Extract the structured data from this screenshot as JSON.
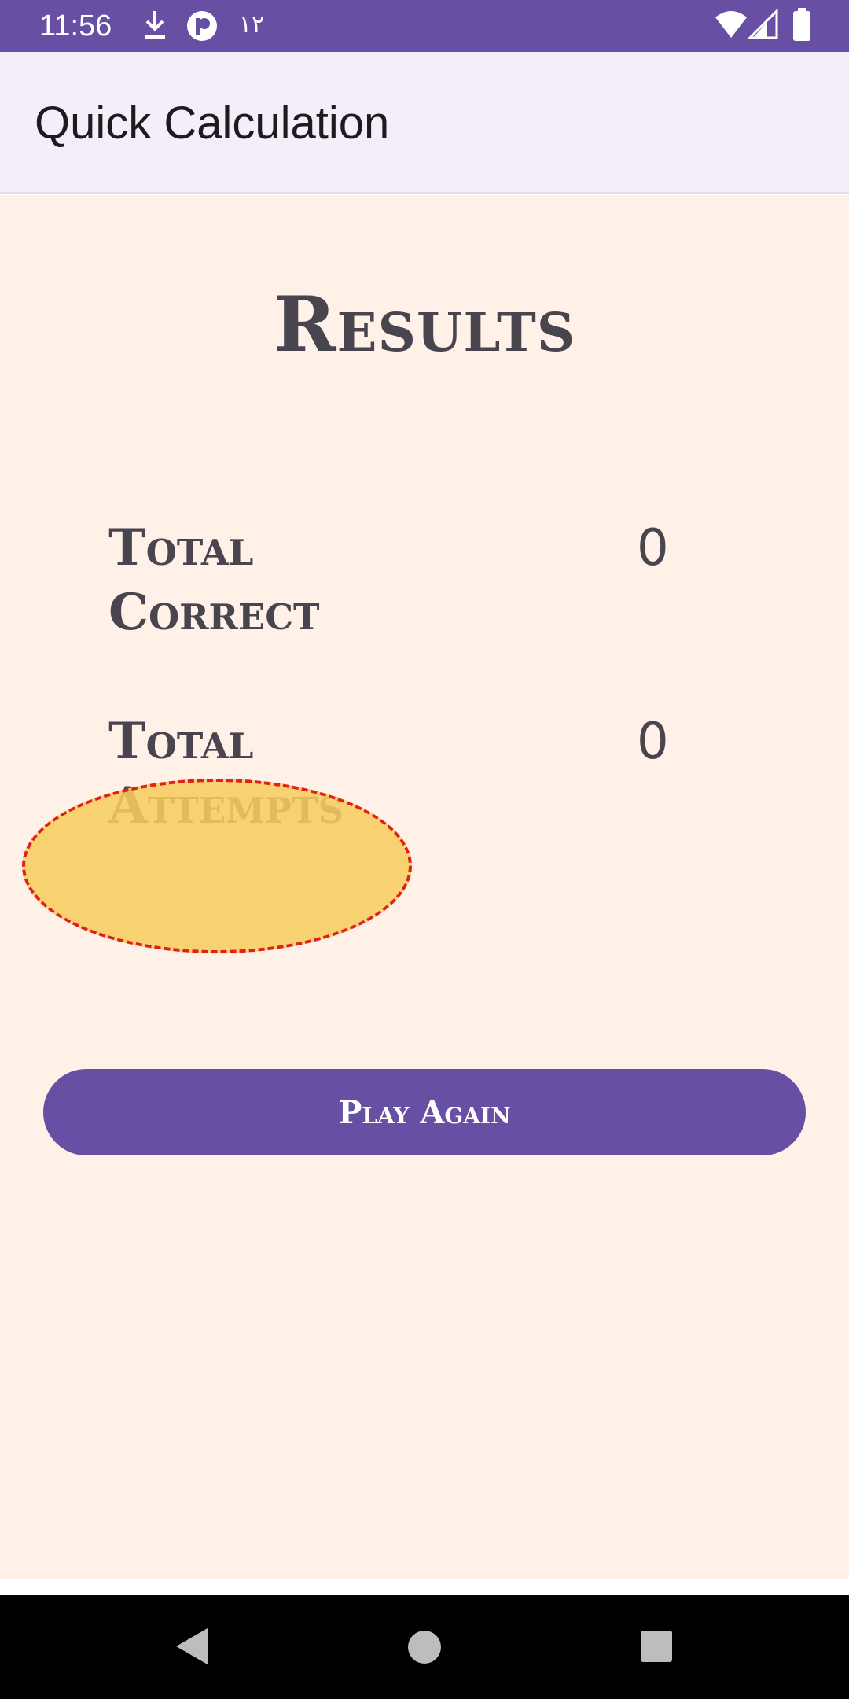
{
  "status_bar": {
    "time": "11:56",
    "extra_text": "۱۲",
    "icons": [
      "download-icon",
      "app-notification-icon",
      "wifi-icon",
      "signal-icon",
      "battery-icon"
    ],
    "color": "#6750a4"
  },
  "app_bar": {
    "title": "Quick Calculation"
  },
  "results": {
    "title": "Results",
    "stats": [
      {
        "label": "Total Correct",
        "value": "0"
      },
      {
        "label": "Total Attempts",
        "value": "0"
      }
    ],
    "play_again_label": "Play Again"
  },
  "nav_bar": {
    "buttons": [
      "back-icon",
      "home-icon",
      "recents-icon"
    ]
  },
  "colors": {
    "accent": "#6750a4",
    "content_background": "#fff0e8",
    "text": "#49454f",
    "highlight_fill": "#f7cd5f",
    "highlight_border": "#e0201c"
  }
}
